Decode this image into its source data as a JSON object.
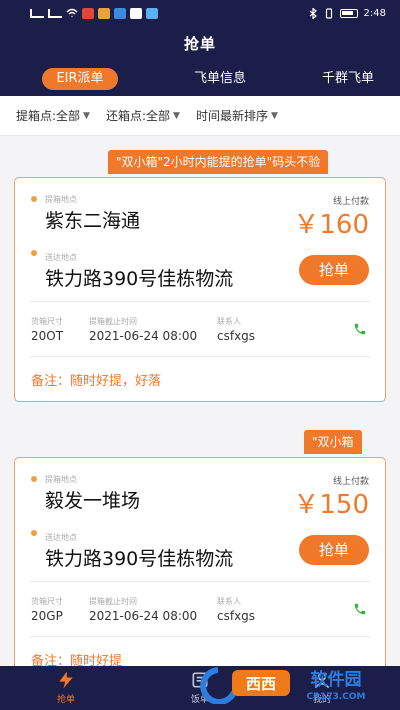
{
  "status_bar": {
    "time": "2:48"
  },
  "header": {
    "title": "抢单"
  },
  "tabs": [
    {
      "label": "EIR派单",
      "active": true
    },
    {
      "label": "飞单信息",
      "active": false
    },
    {
      "label": "千群飞单",
      "active": false
    }
  ],
  "filters": [
    {
      "label": "提箱点:全部"
    },
    {
      "label": "还箱点:全部"
    },
    {
      "label": "时间最新排序"
    }
  ],
  "cards": [
    {
      "tag": "\"双小箱\"2小时内能提的抢单\"码头不验",
      "pickup_label": "提箱地点",
      "pickup": "紫东二海通",
      "delivery_label": "送达地点",
      "delivery": "铁力路390号佳栋物流",
      "pay_label": "线上付款",
      "price": "￥160",
      "button": "抢单",
      "meta": [
        {
          "label": "货箱尺寸",
          "value": "20OT"
        },
        {
          "label": "提箱截止时间",
          "value": "2021-06-24 08:00"
        },
        {
          "label": "联系人",
          "value": "csfxgs"
        }
      ],
      "remark": "备注：随时好提，好落"
    },
    {
      "tag": "\"双小箱",
      "pickup_label": "提箱地点",
      "pickup": "毅发一堆场",
      "delivery_label": "送达地点",
      "delivery": "铁力路390号佳栋物流",
      "pay_label": "线上付款",
      "price": "￥150",
      "button": "抢单",
      "meta": [
        {
          "label": "货箱尺寸",
          "value": "20GP"
        },
        {
          "label": "提箱截止时间",
          "value": "2021-06-24 08:00"
        },
        {
          "label": "联系人",
          "value": "csfxgs"
        }
      ],
      "remark": "备注：随时好提"
    }
  ],
  "bottom_nav": [
    {
      "label": "抢单",
      "icon": "lightning-icon",
      "active": true
    },
    {
      "label": "饭单",
      "icon": "list-icon",
      "active": false
    },
    {
      "label": "我的",
      "icon": "user-icon",
      "active": false
    }
  ],
  "watermark": {
    "brand": "西西软件园",
    "site": "CR173.COM"
  },
  "colors": {
    "header_bg": "#1b1e48",
    "accent": "#f0782a",
    "phone": "#3cb043"
  }
}
